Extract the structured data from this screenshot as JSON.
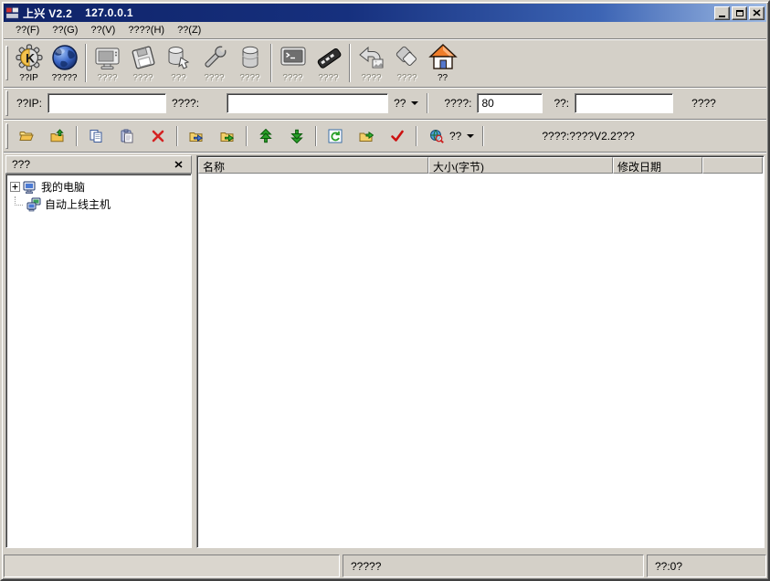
{
  "window": {
    "title_app": "上兴 V2.2",
    "title_host": "127.0.0.1",
    "colors": {
      "window_bg": "#d4d0c8",
      "titlebar_from": "#0f2368",
      "titlebar_to": "#9db9e3",
      "panel_white": "#ffffff",
      "disabled_label_text": "#8a887c",
      "enabled_label_text": "#000000",
      "delete_red": "#d42222",
      "arrow_green": "#2aa02a",
      "home_orange": "#ef7d2a"
    },
    "controls": {
      "minimize_icon": "minimize-icon",
      "maximize_icon": "maximize-icon",
      "close_icon": "close-icon"
    }
  },
  "menu": {
    "items": [
      {
        "label": "??(F)"
      },
      {
        "label": "??(G)"
      },
      {
        "label": "??(V)"
      },
      {
        "label": "????(H)"
      },
      {
        "label": "??(Z)"
      }
    ]
  },
  "toolbar_main": {
    "items": [
      {
        "icon": "settings-gear-icon",
        "label": "??IP",
        "enabled": true
      },
      {
        "icon": "globe-icon",
        "label": "?????",
        "enabled": true
      },
      {
        "icon": "monitor-icon",
        "label": "????",
        "enabled": false
      },
      {
        "icon": "floppy-icon",
        "label": "????",
        "enabled": false
      },
      {
        "icon": "storage-arrow-icon",
        "label": "???",
        "enabled": false
      },
      {
        "icon": "wrench-icon",
        "label": "????",
        "enabled": false
      },
      {
        "icon": "database-icon",
        "label": "????",
        "enabled": false
      },
      {
        "icon": "terminal-icon",
        "label": "????",
        "enabled": false
      },
      {
        "icon": "keyboard-icon",
        "label": "????",
        "enabled": false
      },
      {
        "icon": "undo-photo-icon",
        "label": "????",
        "enabled": false
      },
      {
        "icon": "diamonds-icon",
        "label": "????",
        "enabled": false
      },
      {
        "icon": "home-icon",
        "label": "??",
        "enabled": true
      }
    ]
  },
  "address_bar": {
    "host_ip_label": "??IP:",
    "host_ip_value": "",
    "remote_path_label": "????:",
    "remote_path_value": "",
    "connect_button_label": "??",
    "port_label": "????:",
    "port_value": "80",
    "password_label": "??:",
    "password_value": "",
    "goto_label": "????"
  },
  "toolbar_file": {
    "icons": [
      "folder-open-icon",
      "folder-upload-icon",
      "copy-icon",
      "paste-icon",
      "delete-icon",
      "folder-send-icon",
      "folder-go-icon",
      "upload-arrows-icon",
      "download-arrows-icon",
      "refresh-icon",
      "folder-export-icon",
      "confirm-check-icon",
      "web-search-icon"
    ],
    "search_label": "??",
    "status_text": "????:????V2.2???"
  },
  "sidebar": {
    "header_title": "???",
    "tree": [
      {
        "icon": "my-computer-icon",
        "label": "我的电脑",
        "expandable": true
      },
      {
        "icon": "online-hosts-icon",
        "label": "自动上线主机",
        "expandable": false
      }
    ]
  },
  "file_list": {
    "columns": [
      {
        "label": "名称"
      },
      {
        "label": "大小(字节)"
      },
      {
        "label": "修改日期"
      },
      {
        "label": ""
      }
    ]
  },
  "status_bar": {
    "progress_text": "",
    "center_text": "?????",
    "right_text": "??:0?"
  }
}
